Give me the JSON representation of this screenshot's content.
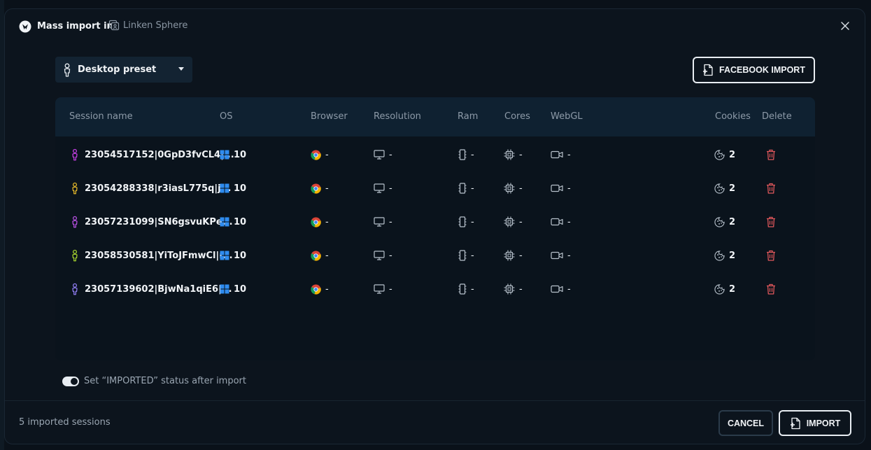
{
  "header": {
    "title": "Mass import in",
    "team": "Linken Sphere"
  },
  "preset": {
    "label": "Desktop preset"
  },
  "facebook_import": {
    "label": "FACEBOOK IMPORT"
  },
  "table": {
    "columns": [
      "Session name",
      "OS",
      "Browser",
      "Resolution",
      "Ram",
      "Cores",
      "WebGL",
      "Cookies",
      "Delete"
    ],
    "rows": [
      {
        "name": "23054517152|0GpD3fvCL4|...",
        "os": "10",
        "browser": "-",
        "resolution": "-",
        "ram": "-",
        "cores": "-",
        "webgl": "-",
        "cookies": "2",
        "person_color": "#c23ee0"
      },
      {
        "name": "23054288338|r3iasL775q|j...",
        "os": "10",
        "browser": "-",
        "resolution": "-",
        "ram": "-",
        "cores": "-",
        "webgl": "-",
        "cookies": "2",
        "person_color": "#e0b52a"
      },
      {
        "name": "23057231099|SN6gsvuKPe...",
        "os": "10",
        "browser": "-",
        "resolution": "-",
        "ram": "-",
        "cores": "-",
        "webgl": "-",
        "cookies": "2",
        "person_color": "#b64fe0"
      },
      {
        "name": "23058530581|YiToJFmwCl|r...",
        "os": "10",
        "browser": "-",
        "resolution": "-",
        "ram": "-",
        "cores": "-",
        "webgl": "-",
        "cookies": "2",
        "person_color": "#a3cf2e"
      },
      {
        "name": "23057139602|BjwNa1qiE6|...",
        "os": "10",
        "browser": "-",
        "resolution": "-",
        "ram": "-",
        "cores": "-",
        "webgl": "-",
        "cookies": "2",
        "person_color": "#8f7cf0"
      }
    ]
  },
  "toggle": {
    "label": "Set “IMPORTED” status after import",
    "on": true
  },
  "footer": {
    "count": "5 imported sessions",
    "cancel": "CANCEL",
    "import": "IMPORT"
  },
  "colors": {
    "delete": "#e0575b",
    "windows": "#2f8cf0"
  },
  "icons": [
    "logo-icon",
    "team-icon",
    "close-icon",
    "person-icon",
    "file-import-icon",
    "windows-icon",
    "chrome-icon",
    "monitor-icon",
    "ram-icon",
    "cpu-icon",
    "video-icon",
    "cookie-icon",
    "trash-icon"
  ]
}
